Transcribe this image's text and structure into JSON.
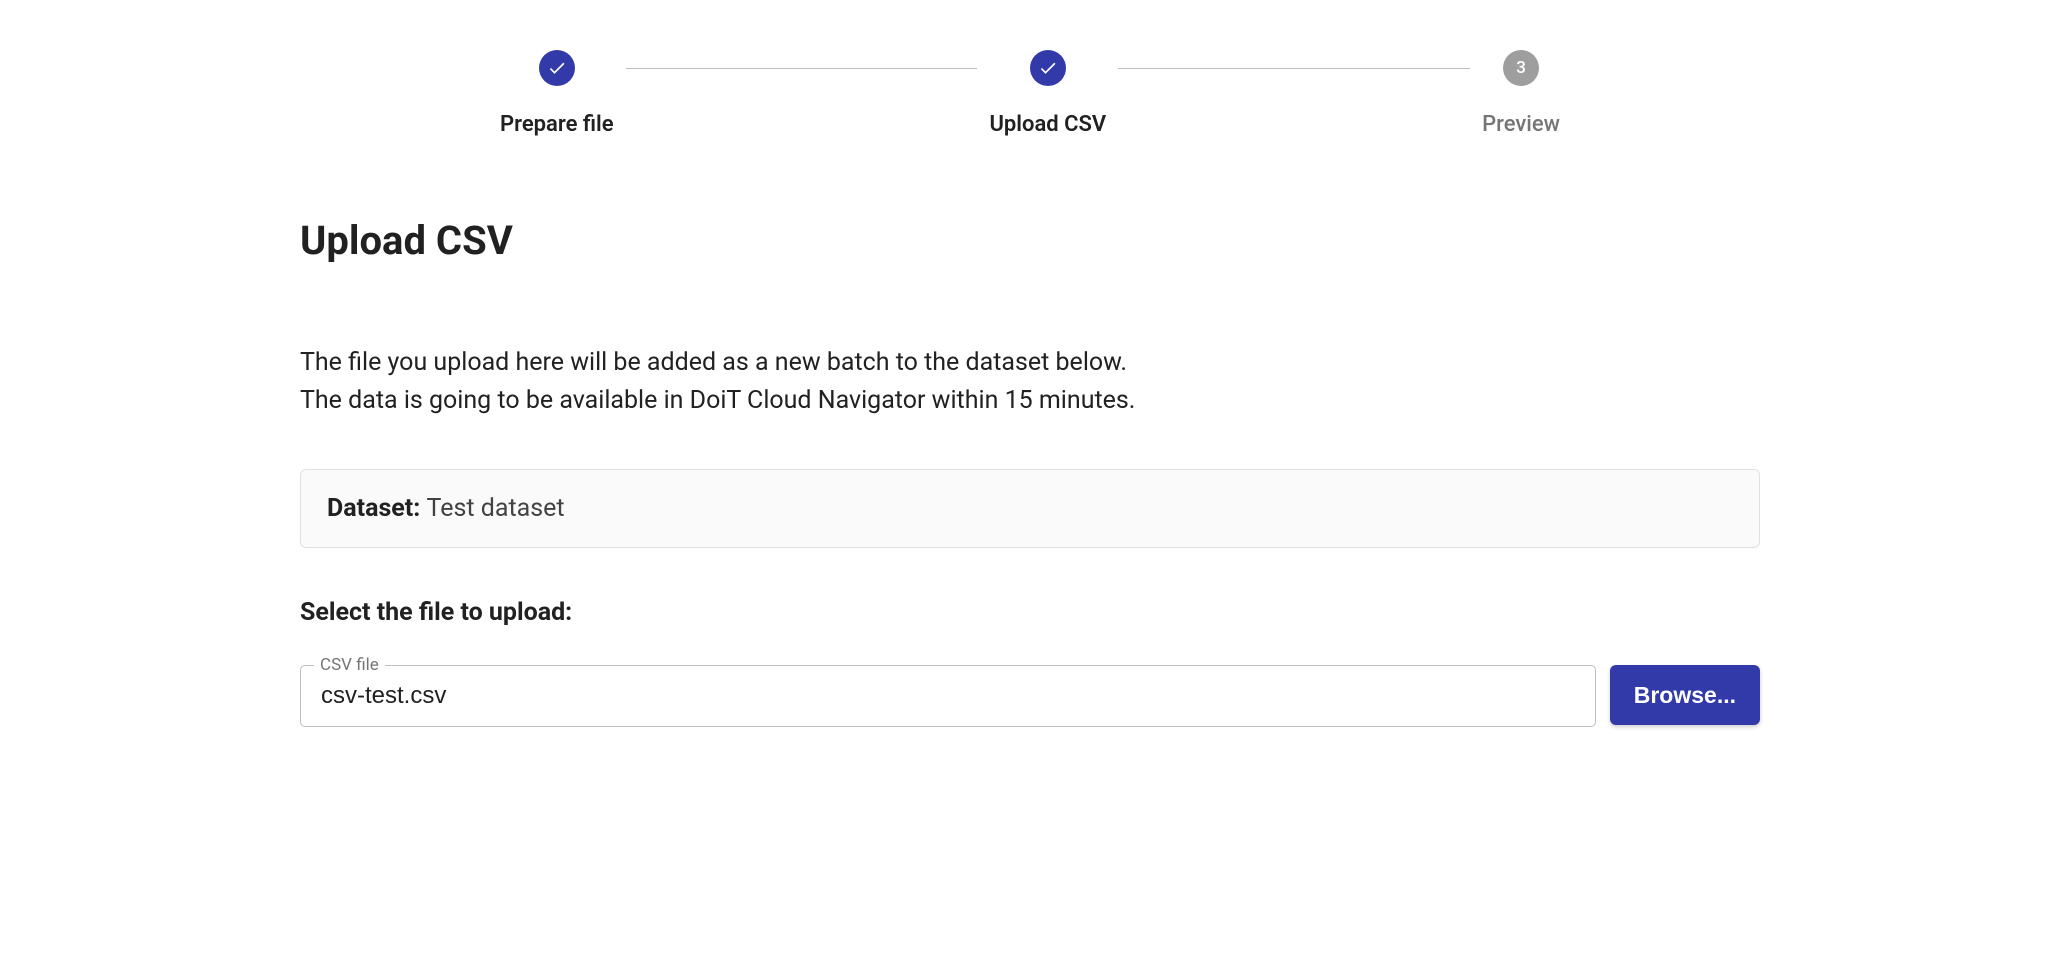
{
  "stepper": {
    "steps": [
      {
        "label": "Prepare file",
        "state": "completed"
      },
      {
        "label": "Upload CSV",
        "state": "completed"
      },
      {
        "label": "Preview",
        "state": "pending",
        "number": "3"
      }
    ]
  },
  "page": {
    "title": "Upload CSV",
    "description_line1": "The file you upload here will be added as a new batch to the dataset below.",
    "description_line2": "The data is going to be available in DoiT Cloud Navigator within 15 minutes."
  },
  "dataset": {
    "label": "Dataset: ",
    "value": "Test dataset"
  },
  "file_select": {
    "prompt": "Select the file to upload:",
    "floating_label": "CSV file",
    "value": "csv-test.csv",
    "browse_label": "Browse..."
  }
}
